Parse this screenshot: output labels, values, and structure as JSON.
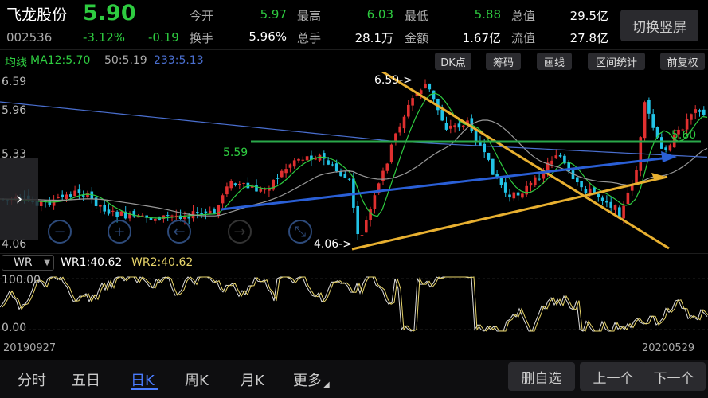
{
  "stock": {
    "name": "飞龙股份",
    "price": "5.90",
    "code": "002536",
    "change_pct": "-3.12%",
    "change": "-0.19"
  },
  "quote": {
    "open_label": "今开",
    "open": "5.97",
    "high_label": "最高",
    "high": "6.03",
    "low_label": "最低",
    "low": "5.88",
    "mcap_label": "总值",
    "mcap": "29.5亿",
    "turnover_label": "换手",
    "turnover": "5.96%",
    "volume_label": "总手",
    "volume": "28.1万",
    "amount_label": "金额",
    "amount": "1.67亿",
    "float_label": "流值",
    "float": "27.8亿"
  },
  "switch_label": "切换竖屏",
  "ma": {
    "title": "均线",
    "ma12": "MA12:5.70",
    "ma50": "50:5.19",
    "ma233": "233:5.13"
  },
  "toolbar": [
    "DK点",
    "筹码",
    "画线",
    "区间统计",
    "前复权"
  ],
  "axis": {
    "y1": "6.59",
    "y2": "5.96",
    "y3": "5.33",
    "y4": "4.06"
  },
  "annotations": {
    "high": "6.59->",
    "low": "4.06->",
    "mid": "5.59",
    "right": "5.60"
  },
  "wr": {
    "select": "WR",
    "wr1": "WR1:40.62",
    "wr2": "WR2:40.62",
    "top": "100.00",
    "bottom": "0.00"
  },
  "dates": {
    "start": "20190927",
    "end": "20200529"
  },
  "tabs": [
    "分时",
    "五日",
    "日K",
    "周K",
    "月K",
    "更多"
  ],
  "actions": {
    "delete": "删自选",
    "prev": "上一个",
    "next": "下一个"
  },
  "colors": {
    "up": "#e03030",
    "down": "#22c3e6",
    "ma12": "#2ecc40",
    "ma50": "#999999",
    "ma233": "#4a6fd0",
    "wr1": "#dddddd",
    "wr2": "#e8d56a",
    "trend": "#e8b030",
    "arrow": "#2a5fd6"
  }
}
